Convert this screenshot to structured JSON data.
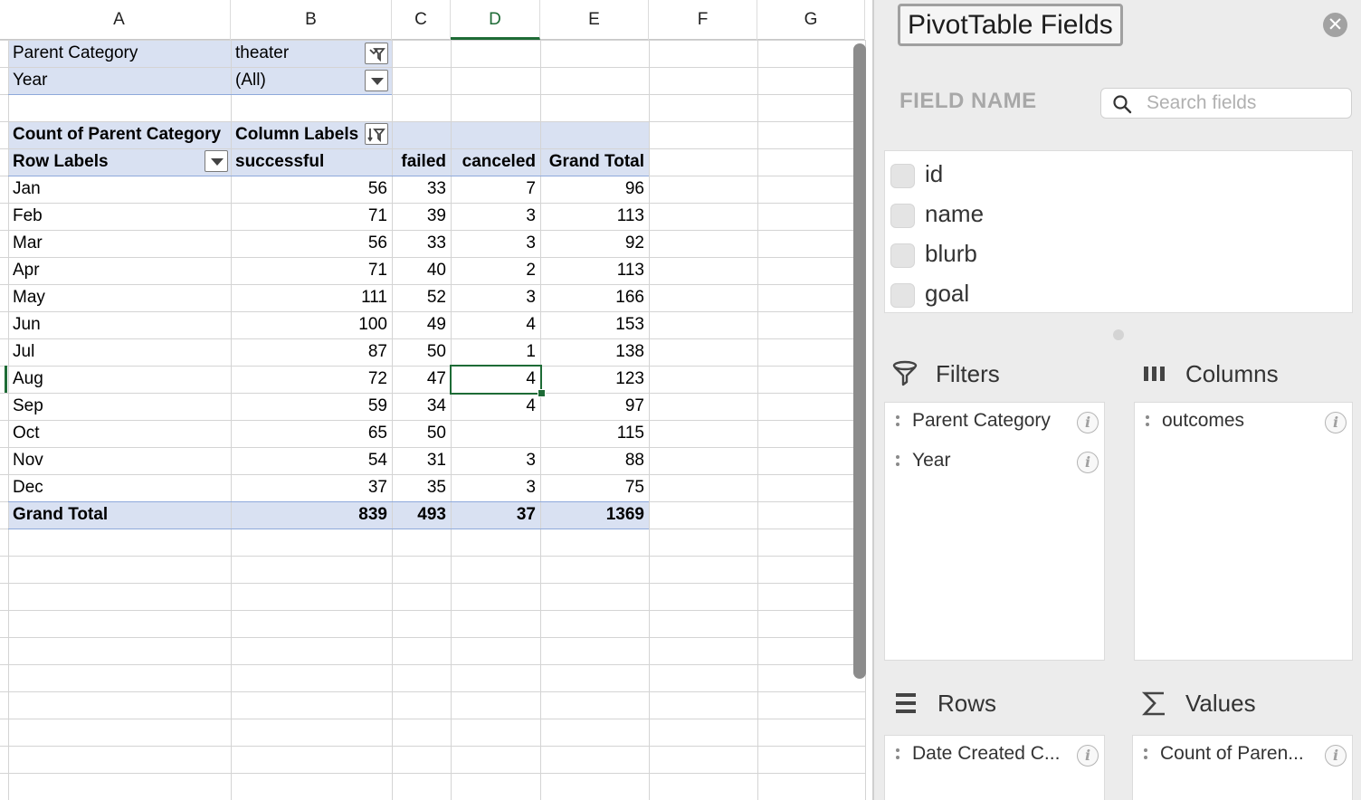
{
  "sheet": {
    "columns": [
      "A",
      "B",
      "C",
      "D",
      "E",
      "F",
      "G"
    ],
    "selected_column": "D",
    "filters": [
      {
        "label": "Parent Category",
        "value": "theater"
      },
      {
        "label": "Year",
        "value": "(All)"
      }
    ],
    "pivot": {
      "value_field": "Count of Parent Category",
      "column_labels": "Column Labels",
      "row_labels": "Row Labels",
      "col_headers": [
        "successful",
        "failed",
        "canceled",
        "Grand Total"
      ],
      "rows": [
        {
          "label": "Jan",
          "values": [
            "56",
            "33",
            "7",
            "96"
          ]
        },
        {
          "label": "Feb",
          "values": [
            "71",
            "39",
            "3",
            "113"
          ]
        },
        {
          "label": "Mar",
          "values": [
            "56",
            "33",
            "3",
            "92"
          ]
        },
        {
          "label": "Apr",
          "values": [
            "71",
            "40",
            "2",
            "113"
          ]
        },
        {
          "label": "May",
          "values": [
            "111",
            "52",
            "3",
            "166"
          ]
        },
        {
          "label": "Jun",
          "values": [
            "100",
            "49",
            "4",
            "153"
          ]
        },
        {
          "label": "Jul",
          "values": [
            "87",
            "50",
            "1",
            "138"
          ]
        },
        {
          "label": "Aug",
          "values": [
            "72",
            "47",
            "4",
            "123"
          ]
        },
        {
          "label": "Sep",
          "values": [
            "59",
            "34",
            "4",
            "97"
          ]
        },
        {
          "label": "Oct",
          "values": [
            "65",
            "50",
            "",
            "115"
          ]
        },
        {
          "label": "Nov",
          "values": [
            "54",
            "31",
            "3",
            "88"
          ]
        },
        {
          "label": "Dec",
          "values": [
            "37",
            "35",
            "3",
            "75"
          ]
        }
      ],
      "grand_total": {
        "label": "Grand Total",
        "values": [
          "839",
          "493",
          "37",
          "1369"
        ]
      }
    }
  },
  "pane": {
    "title": "PivotTable Fields",
    "close_icon": "close-icon",
    "field_name_label": "FIELD NAME",
    "search_placeholder": "Search fields",
    "fields": [
      "id",
      "name",
      "blurb",
      "goal"
    ],
    "areas": {
      "filters": {
        "label": "Filters",
        "items": [
          "Parent Category",
          "Year"
        ]
      },
      "columns": {
        "label": "Columns",
        "items": [
          "outcomes"
        ]
      },
      "rows": {
        "label": "Rows",
        "items": [
          "Date Created C..."
        ]
      },
      "values": {
        "label": "Values",
        "items": [
          "Count of Paren..."
        ]
      }
    }
  }
}
